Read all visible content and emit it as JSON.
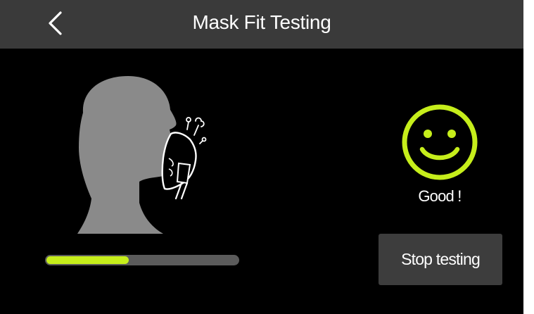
{
  "header": {
    "title": "Mask Fit Testing",
    "back_icon": "chevron-left-icon"
  },
  "illustration": {
    "head_icon": "head-profile-with-mask-icon",
    "leak_icon": "air-leak-icon"
  },
  "progress": {
    "fraction": 0.43
  },
  "result": {
    "icon": "smiley-face-icon",
    "status": "Good !"
  },
  "actions": {
    "stop_label": "Stop testing"
  },
  "colors": {
    "accent": "#c6ee1b",
    "header_bg": "#3a3a3a",
    "background": "#000000",
    "head_gray": "#8a8a8a",
    "button_bg": "#3d3d3d",
    "track": "#5b5b5b"
  }
}
